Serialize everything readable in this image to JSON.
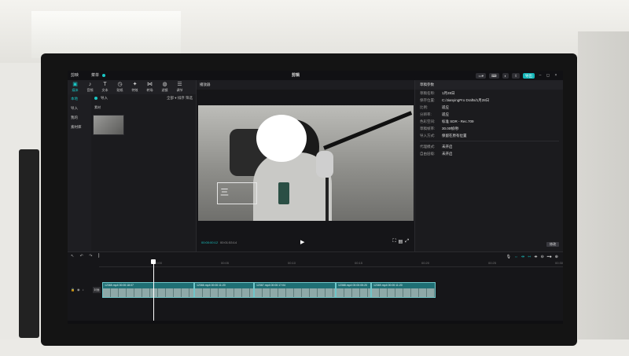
{
  "titlebar": {
    "logo": "剪映",
    "menu": "菜单",
    "center": "剪辑",
    "right_pill_1": "",
    "right_pill_2": "",
    "export": "导出"
  },
  "toolbar": {
    "items": [
      {
        "glyph": "▣",
        "label": "媒体"
      },
      {
        "glyph": "♪",
        "label": "音频"
      },
      {
        "glyph": "T",
        "label": "文本"
      },
      {
        "glyph": "◷",
        "label": "贴纸"
      },
      {
        "glyph": "✦",
        "label": "特效"
      },
      {
        "glyph": "⋈",
        "label": "转场"
      },
      {
        "glyph": "◍",
        "label": "滤镜"
      },
      {
        "glyph": "☰",
        "label": "调节"
      }
    ]
  },
  "sidenav": {
    "items": [
      "本地",
      "导入",
      "我的",
      "素材库"
    ]
  },
  "media": {
    "import_label": "导入",
    "sub_label": "素材",
    "tools": "全部 ▾  排序  筛选",
    "thumb_label": ""
  },
  "player": {
    "title": "播放器",
    "overlay_text": "三",
    "time_current": "00:00:00:12",
    "time_total": "00:01:53:14"
  },
  "panel": {
    "title": "草稿参数",
    "rows": [
      {
        "k": "草稿名称:",
        "v": "1月28日"
      },
      {
        "k": "保存位置:",
        "v": "C:/JianyingPro Drafts/1月28日"
      },
      {
        "k": "比例:",
        "v": "适应"
      },
      {
        "k": "分辨率:",
        "v": "适应"
      },
      {
        "k": "色彩空间:",
        "v": "标准 SDR - Rec.709"
      },
      {
        "k": "草稿帧率:",
        "v": "30.00帧/秒"
      },
      {
        "k": "导入方式:",
        "v": "保留在原有位置"
      }
    ],
    "rows2": [
      {
        "k": "代理模式:",
        "v": "未开启"
      },
      {
        "k": "自由层级:",
        "v": "未开启"
      }
    ],
    "modify": "修改"
  },
  "timeline": {
    "ruler_ticks": [
      "00:00",
      "00:05",
      "00:10",
      "00:15",
      "00:20",
      "00:25",
      "00:30"
    ],
    "clips": [
      {
        "label": "12365.mp4  00:00:18:07",
        "flex": 115
      },
      {
        "label": "12366.mp4  00:00:11:20",
        "flex": 75
      },
      {
        "label": "12367.mp4  00:00:17:04",
        "flex": 102
      },
      {
        "label": "12368.mp4  00:00:05:20",
        "flex": 44
      },
      {
        "label": "12369.mp4  00:00:11:20",
        "flex": 80
      }
    ],
    "cover_label": "封面"
  }
}
